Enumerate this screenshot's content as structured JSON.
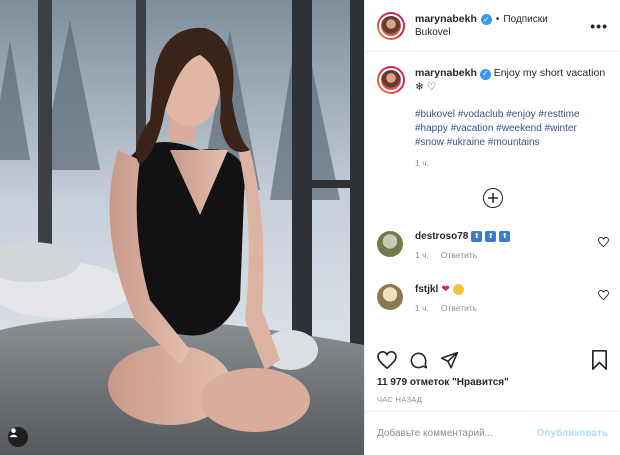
{
  "post": {
    "username": "marynabekh",
    "follow_label": "Подписки",
    "location": "Bukovel",
    "caption": "Enjoy my short vacation",
    "hashtags": "#bukovel #vodaclub #enjoy #resttime #happy #vacation #weekend #winter #snow #ukraine #mountains",
    "caption_time": "1 ч.",
    "likes": "11 979 отметок \"Нравится\"",
    "posted_ago": "ЧАС НАЗАД"
  },
  "comments": [
    {
      "username": "destroso78",
      "time": "1 ч.",
      "reply_label": "Ответить"
    },
    {
      "username": "fstjkl",
      "time": "1 ч.",
      "reply_label": "Ответить"
    }
  ],
  "add_comment": {
    "placeholder": "Добавьте комментарий...",
    "publish_label": "Опубликовать"
  },
  "icons": {
    "verified": "verified-badge-icon",
    "more": "more-options-icon",
    "like": "heart-icon",
    "comment": "comment-icon",
    "share": "share-icon",
    "save": "bookmark-icon",
    "load_more": "plus-circle-icon"
  },
  "colors": {
    "link": "#385185",
    "verified": "#3897f0",
    "publish_disabled": "#b2dffc",
    "muted": "#8e8e8e"
  }
}
